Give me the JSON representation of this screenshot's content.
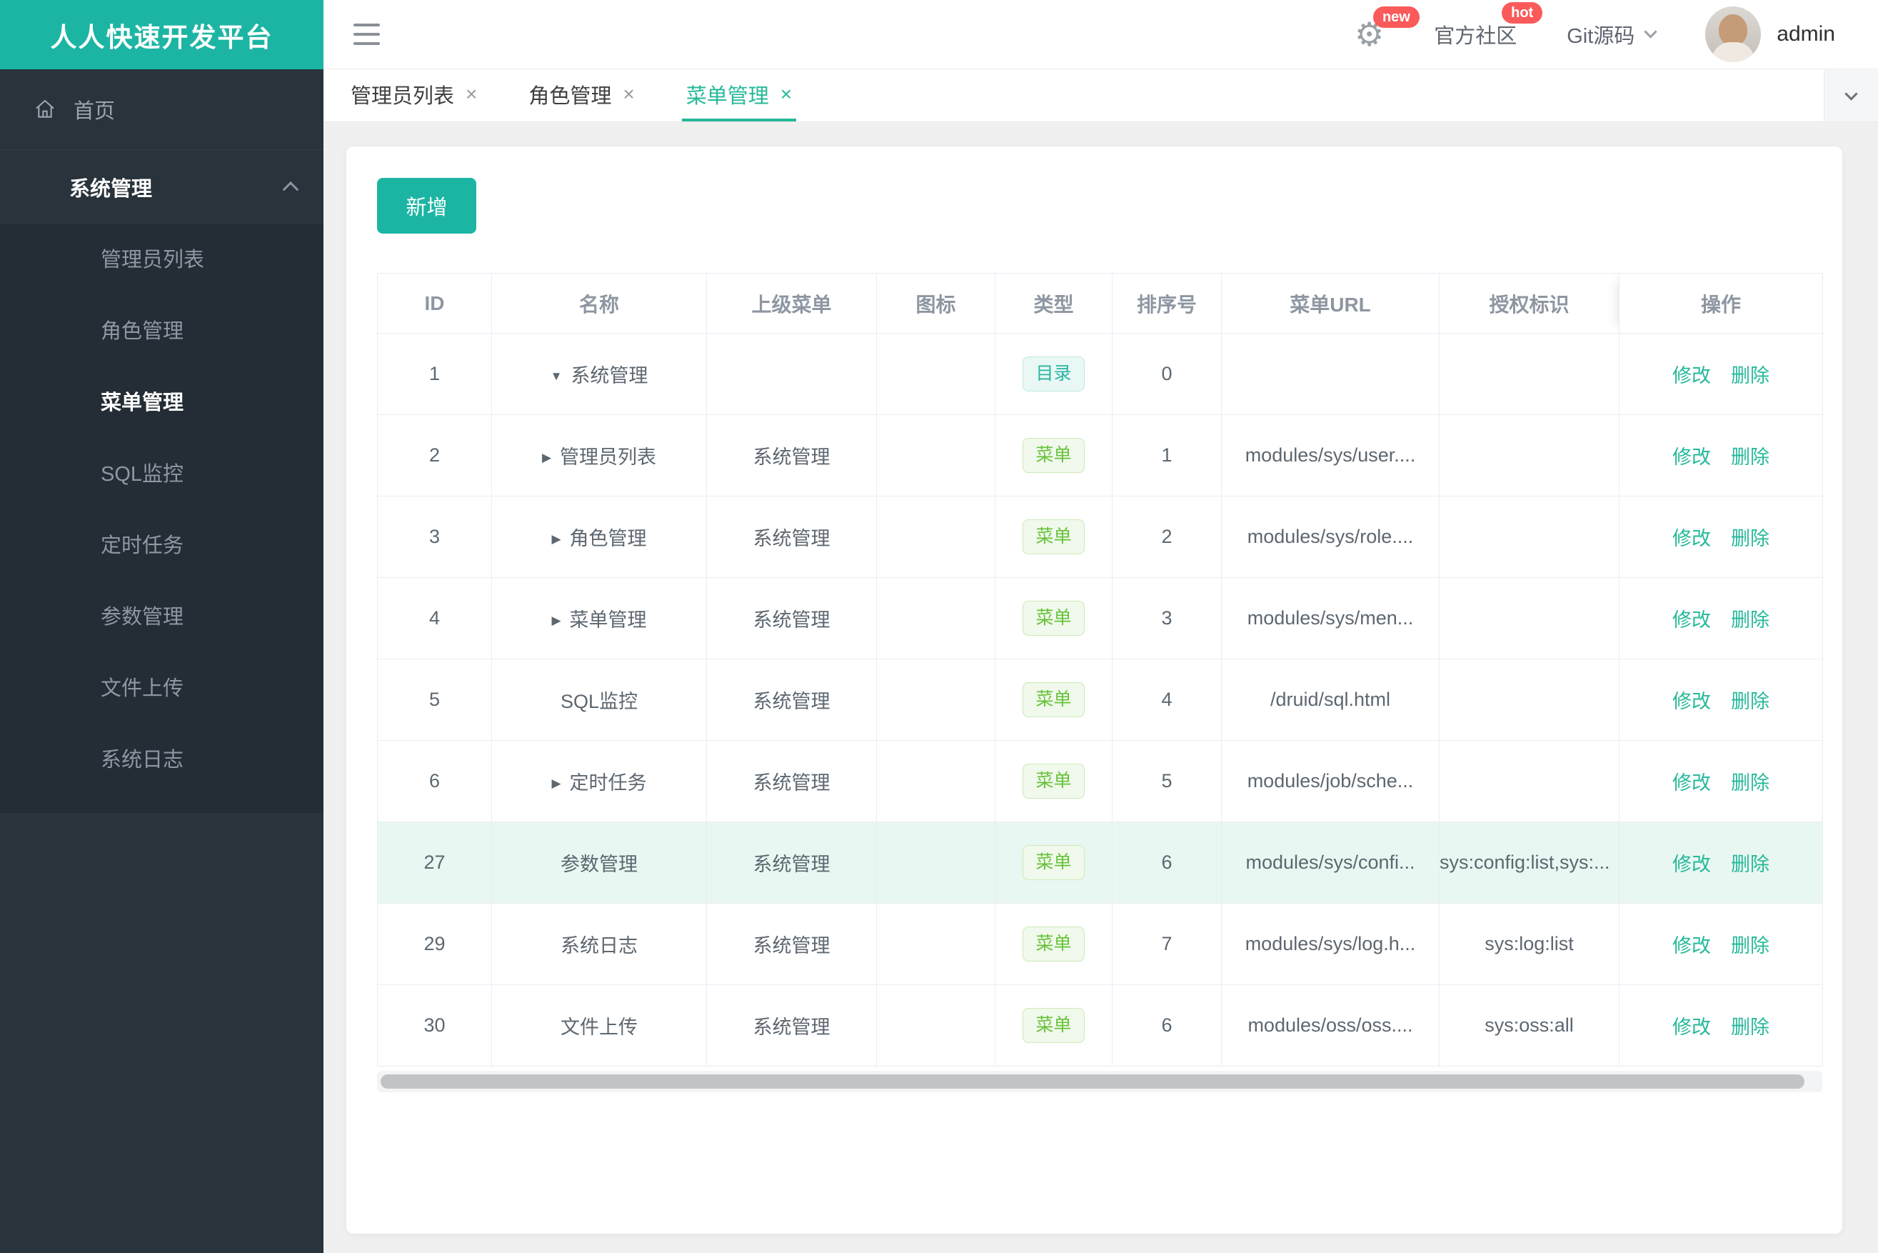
{
  "app": {
    "title": "人人快速开发平台"
  },
  "topbar": {
    "settings_badge": "new",
    "community": {
      "label": "官方社区",
      "badge": "hot"
    },
    "git": {
      "label": "Git源码"
    },
    "user": {
      "name": "admin"
    }
  },
  "tabbar": {
    "tabs": [
      {
        "label": "管理员列表",
        "close": "×",
        "active": false
      },
      {
        "label": "角色管理",
        "close": "×",
        "active": false
      },
      {
        "label": "菜单管理",
        "close": "×",
        "active": true
      }
    ]
  },
  "sidebar": {
    "home": "首页",
    "group": "系统管理",
    "items": [
      {
        "label": "管理员列表",
        "active": false
      },
      {
        "label": "角色管理",
        "active": false
      },
      {
        "label": "菜单管理",
        "active": true
      },
      {
        "label": "SQL监控",
        "active": false
      },
      {
        "label": "定时任务",
        "active": false
      },
      {
        "label": "参数管理",
        "active": false
      },
      {
        "label": "文件上传",
        "active": false
      },
      {
        "label": "系统日志",
        "active": false
      }
    ]
  },
  "content": {
    "add_button": "新增",
    "table": {
      "columns": [
        "ID",
        "名称",
        "上级菜单",
        "图标",
        "类型",
        "排序号",
        "菜单URL",
        "授权标识",
        "操作"
      ],
      "edit_label": "修改",
      "delete_label": "删除",
      "rows": [
        {
          "id": "1",
          "caret": "▼",
          "name": "系统管理",
          "parent": "",
          "icon": "",
          "type": "目录",
          "order": "0",
          "url": "",
          "perm": ""
        },
        {
          "id": "2",
          "caret": "▶",
          "name": "管理员列表",
          "parent": "系统管理",
          "icon": "",
          "type": "菜单",
          "order": "1",
          "url": "modules/sys/user....",
          "perm": ""
        },
        {
          "id": "3",
          "caret": "▶",
          "name": "角色管理",
          "parent": "系统管理",
          "icon": "",
          "type": "菜单",
          "order": "2",
          "url": "modules/sys/role....",
          "perm": ""
        },
        {
          "id": "4",
          "caret": "▶",
          "name": "菜单管理",
          "parent": "系统管理",
          "icon": "",
          "type": "菜单",
          "order": "3",
          "url": "modules/sys/men...",
          "perm": ""
        },
        {
          "id": "5",
          "caret": "",
          "name": "SQL监控",
          "parent": "系统管理",
          "icon": "",
          "type": "菜单",
          "order": "4",
          "url": "/druid/sql.html",
          "perm": ""
        },
        {
          "id": "6",
          "caret": "▶",
          "name": "定时任务",
          "parent": "系统管理",
          "icon": "",
          "type": "菜单",
          "order": "5",
          "url": "modules/job/sche...",
          "perm": ""
        },
        {
          "id": "27",
          "caret": "",
          "name": "参数管理",
          "parent": "系统管理",
          "icon": "",
          "type": "菜单",
          "order": "6",
          "url": "modules/sys/confi...",
          "perm": "sys:config:list,sys:..."
        },
        {
          "id": "29",
          "caret": "",
          "name": "系统日志",
          "parent": "系统管理",
          "icon": "",
          "type": "菜单",
          "order": "7",
          "url": "modules/sys/log.h...",
          "perm": "sys:log:list"
        },
        {
          "id": "30",
          "caret": "",
          "name": "文件上传",
          "parent": "系统管理",
          "icon": "",
          "type": "菜单",
          "order": "6",
          "url": "modules/oss/oss....",
          "perm": "sys:oss:all"
        }
      ]
    }
  },
  "colors": {
    "brand_teal": "#1cb5a3",
    "link_teal": "#26b99a",
    "badge_red": "#fa5a5a",
    "sidebar_bg": "#29333c",
    "tag_dir_text": "#2ab5a3",
    "tag_menu_text": "#67c23a",
    "row_highlight": "#e9f7f2"
  }
}
